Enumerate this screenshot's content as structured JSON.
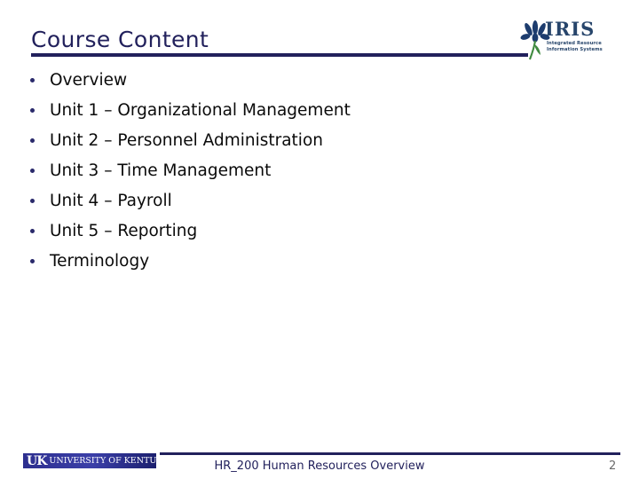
{
  "slide": {
    "title": "Course Content",
    "page_number": "2",
    "footer_text": "HR_200 Human Resources Overview",
    "accent_color": "#22215c",
    "bullet_color": "#2a2a6b",
    "body_text_color": "#0a0a0a",
    "background_color": "#ffffff"
  },
  "iris_logo": {
    "wordmark": "IRIS",
    "tagline_line1": "Integrated Resource",
    "tagline_line2": "Information Systems",
    "flower_color": "#1d3c6e",
    "stem_color": "#3f8a3f",
    "wordmark_color": "#27456b"
  },
  "uk_logo": {
    "mark": "UK",
    "name": "UNIVERSITY OF KENTUCKY",
    "bar_color": "#2d2f8f",
    "text_color": "#ffffff"
  },
  "content": {
    "items": [
      {
        "label": "Overview"
      },
      {
        "label": "Unit 1 – Organizational Management"
      },
      {
        "label": "Unit 2 – Personnel Administration"
      },
      {
        "label": "Unit 3 – Time Management"
      },
      {
        "label": "Unit 4 – Payroll"
      },
      {
        "label": "Unit 5 – Reporting"
      },
      {
        "label": "Terminology"
      }
    ]
  }
}
